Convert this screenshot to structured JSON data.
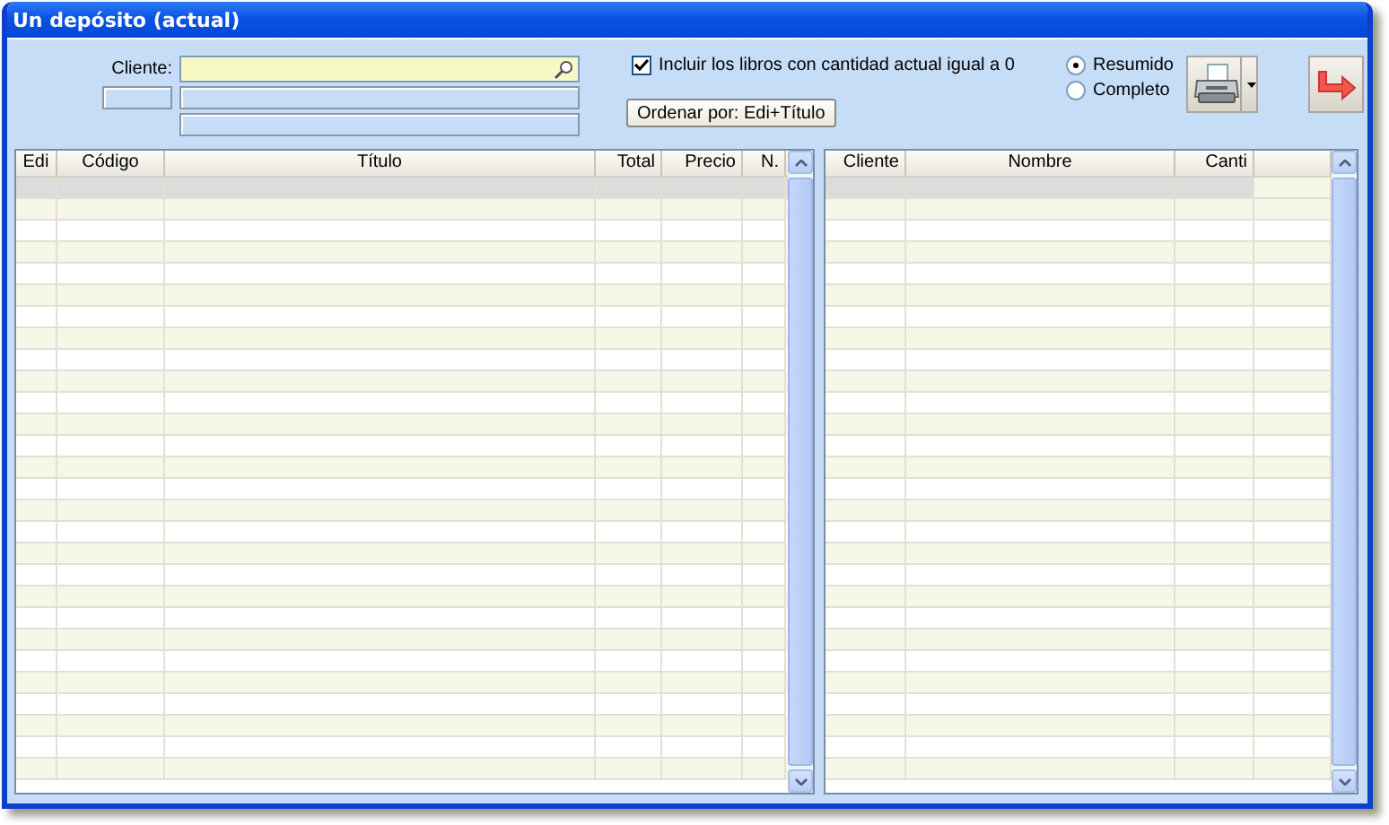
{
  "window": {
    "title": "Un depósito (actual)"
  },
  "filter": {
    "client_label": "Cliente:",
    "include_zero": {
      "label": "Incluir los libros con cantidad actual igual a 0",
      "checked": true
    },
    "sort_button": "Ordenar por: Edi+Título"
  },
  "report_mode": [
    {
      "label": "Resumido",
      "selected": true
    },
    {
      "label": "Completo",
      "selected": false
    }
  ],
  "books_table": {
    "columns": [
      "Edi",
      "Código",
      "Título",
      "Total",
      "Precio",
      "N."
    ],
    "highlight_first_row": true
  },
  "clients_table": {
    "columns": [
      "Cliente",
      "Nombre",
      "Canti"
    ],
    "highlight_first_row": true
  }
}
